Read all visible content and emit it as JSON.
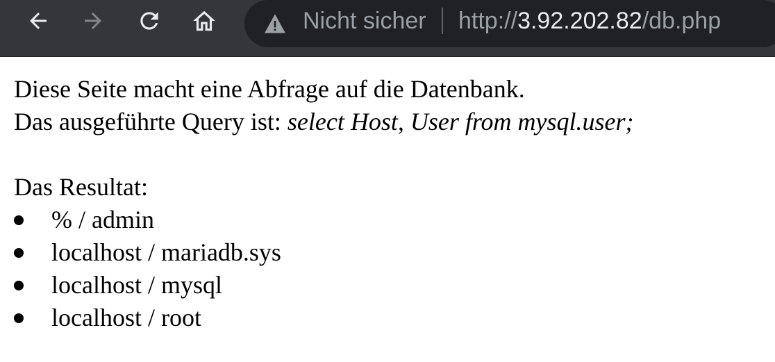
{
  "browser": {
    "security_label": "Nicht sicher",
    "url_scheme": "http://",
    "url_host": "3.92.202.82",
    "url_path": "/db.php",
    "icons": [
      "back-arrow-icon",
      "forward-arrow-icon",
      "reload-icon",
      "home-icon",
      "warning-icon"
    ],
    "colors": {
      "toolbar_bg": "#35363a",
      "omnibox_bg": "#202124",
      "muted_text": "#9aa0a6",
      "host_text": "#e8eaed",
      "forward_disabled": "#80868b"
    }
  },
  "page": {
    "intro": "Diese Seite macht eine Abfrage auf die Datenbank.",
    "query_label": "Das ausgeführte Query ist: ",
    "query": "select Host, User from mysql.user;",
    "result_label": "Das Resultat:",
    "results": [
      "% / admin",
      "localhost / mariadb.sys",
      "localhost / mysql",
      "localhost / root"
    ]
  }
}
